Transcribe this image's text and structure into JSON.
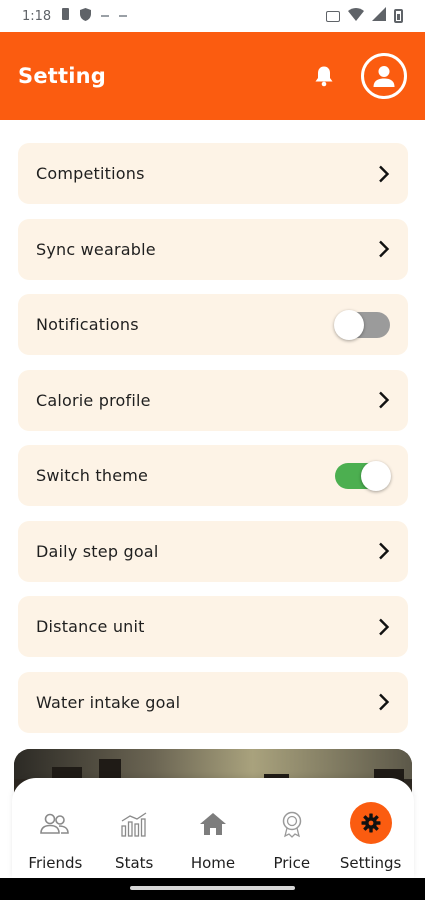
{
  "status_bar": {
    "time": "1:18"
  },
  "header": {
    "title": "Setting"
  },
  "colors": {
    "accent": "#fb5c10",
    "row_bg": "#fdf3e6",
    "toggle_on": "#4caf50",
    "toggle_off": "#9b9b9b"
  },
  "settings": [
    {
      "label": "Competitions",
      "trail": "chevron"
    },
    {
      "label": "Sync wearable",
      "trail": "chevron"
    },
    {
      "label": "Notifications",
      "trail": "toggle",
      "on": false
    },
    {
      "label": "Calorie profile",
      "trail": "chevron"
    },
    {
      "label": "Switch theme",
      "trail": "toggle",
      "on": true
    },
    {
      "label": "Daily step goal",
      "trail": "chevron"
    },
    {
      "label": "Distance unit",
      "trail": "chevron"
    },
    {
      "label": "Water intake goal",
      "trail": "chevron"
    }
  ],
  "nav": {
    "items": [
      {
        "label": "Friends",
        "icon": "friends-icon"
      },
      {
        "label": "Stats",
        "icon": "stats-icon"
      },
      {
        "label": "Home",
        "icon": "home-icon"
      },
      {
        "label": "Price",
        "icon": "award-icon"
      },
      {
        "label": "Settings",
        "icon": "gear-icon",
        "active": true
      }
    ]
  }
}
